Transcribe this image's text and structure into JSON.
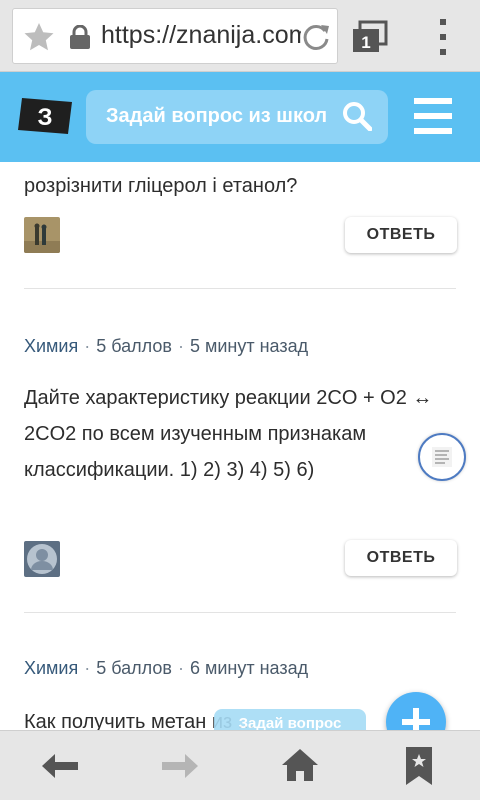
{
  "browser": {
    "url": "https://znanija.com",
    "tab_count": "1"
  },
  "header": {
    "logo_text": "З",
    "search_placeholder": "Задай вопрос из школ"
  },
  "questions": [
    {
      "text": "розрізнити гліцерол і етанол?",
      "answer_label": "ОТВЕТЬ"
    },
    {
      "subject": "Химия",
      "points": "5 баллов",
      "time": "5 минут назад",
      "text": "Дайте характеристику реакции 2CO + O2 ↔ 2CO2 по всем изученным признакам классификации. 1) 2) 3) 4) 5) 6)",
      "answer_label": "ОТВЕТЬ"
    },
    {
      "subject": "Химия",
      "points": "5 баллов",
      "time": "6 минут назад",
      "text": "Как получить метан из ..."
    }
  ],
  "ask_button_label": "Задай вопрос",
  "colors": {
    "brand": "#5bc0f2",
    "fab": "#4fb3f6"
  }
}
